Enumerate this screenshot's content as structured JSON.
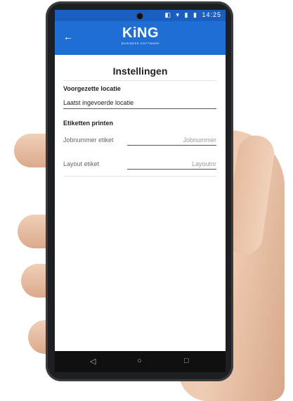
{
  "status": {
    "time": "14:25",
    "icons": [
      "sim-icon",
      "signal-icon",
      "wifi-icon",
      "battery-icon"
    ]
  },
  "appbar": {
    "back_label": "←",
    "logo_text": "KiNG",
    "logo_subtitle": "BUSINESS SOFTWARE"
  },
  "page": {
    "title": "Instellingen",
    "sections": [
      {
        "label": "Voorgezette locatie",
        "value": "Laatst ingevoerde locatie"
      },
      {
        "label": "Etiketten printen",
        "fields": [
          {
            "label": "Jobnummer etiket",
            "placeholder": "Jobnummer"
          },
          {
            "label": "Layout etiket",
            "placeholder": "Layoutnr"
          }
        ]
      }
    ]
  },
  "navbar": {
    "back": "◁",
    "home": "○",
    "recents": "□"
  },
  "colors": {
    "appbar": "#1f6ed4",
    "statusbar": "#1a5fc0",
    "phone_frame": "#1e1f22",
    "skin": "#efcdb4"
  }
}
